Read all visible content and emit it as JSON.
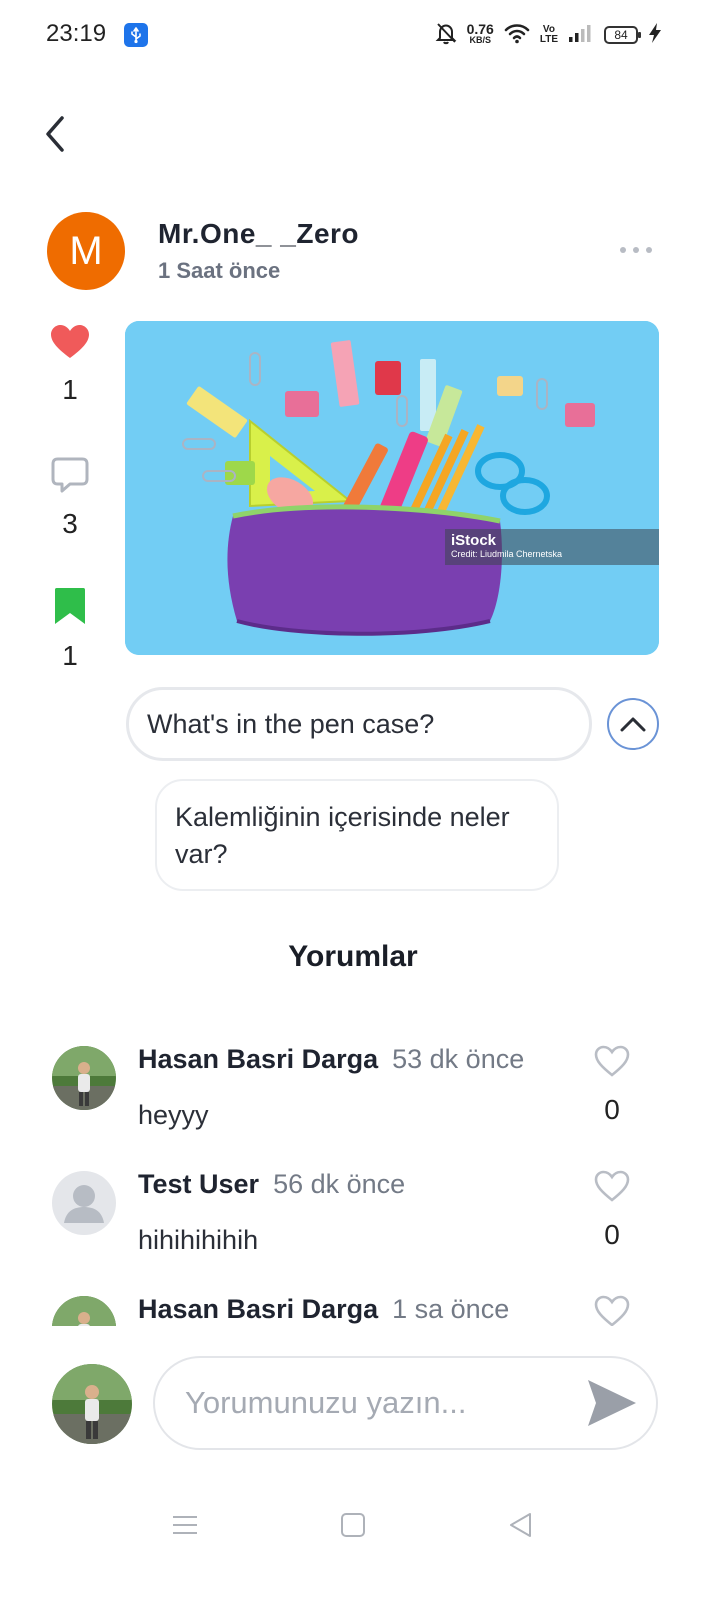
{
  "status_bar": {
    "time": "23:19",
    "net_speed_value": "0.76",
    "net_speed_unit": "KB/S",
    "volte_top": "Vo",
    "volte_bottom": "LTE",
    "battery": "84",
    "accent_color": "#1e74ea"
  },
  "post": {
    "author_initial": "M",
    "author_name": "Mr.One_ _Zero",
    "time": "1 Saat önce",
    "avatar_color": "#ef6c00",
    "likes": "1",
    "comments": "3",
    "saves": "1",
    "image": {
      "watermark_brand": "iStock",
      "watermark_credit": "Credit: Liudmila Chernetska"
    },
    "question": "What's in the pen case?",
    "translation": "Kalemliğinin içerisinde neler var?"
  },
  "comments_section": {
    "title": "Yorumlar",
    "items": [
      {
        "name": "Hasan Basri Darga",
        "time": "53 dk önce",
        "text": "heyyy",
        "likes": "0"
      },
      {
        "name": "Test User",
        "time": "56 dk önce",
        "text": "hihihihihih",
        "likes": "0"
      },
      {
        "name": "Hasan Basri Darga",
        "time": "1 sa önce",
        "text": "",
        "likes": ""
      }
    ]
  },
  "composer": {
    "placeholder": "Yorumunuzu yazın..."
  },
  "icons": {
    "like": "heart-icon",
    "comment": "chat-bubble-icon",
    "save": "bookmark-icon",
    "send": "send-icon"
  },
  "colors": {
    "like": "#f05a5a",
    "save": "#2fbe4a",
    "collapse_border": "#6a93d6"
  }
}
